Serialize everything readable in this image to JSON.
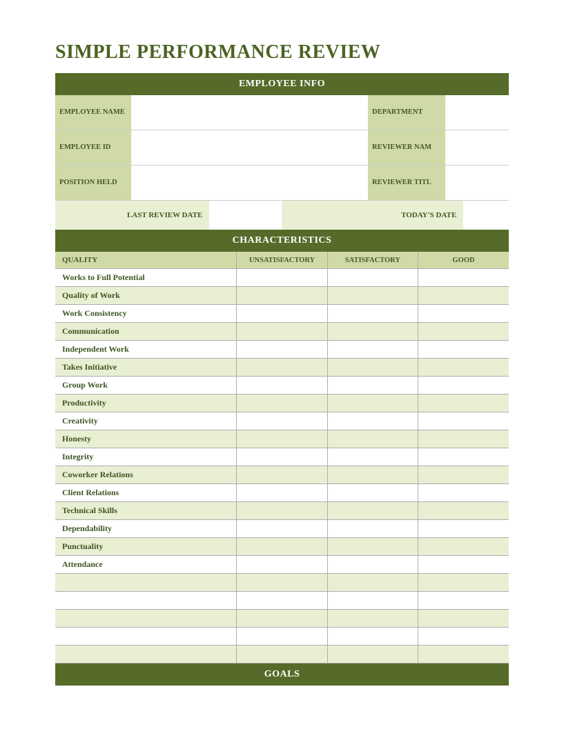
{
  "title": "SIMPLE PERFORMANCE REVIEW",
  "sections": {
    "employee_info": "EMPLOYEE INFO",
    "characteristics": "CHARACTERISTICS",
    "goals": "GOALS"
  },
  "employee_info": {
    "labels": {
      "employee_name": "EMPLOYEE NAME",
      "employee_id": "EMPLOYEE ID",
      "position_held": "POSITION HELD",
      "department": "DEPARTMENT",
      "reviewer_name": "REVIEWER NAM",
      "reviewer_title": "REVIEWER TITL",
      "last_review_date": "LAST REVIEW DATE",
      "todays_date": "TODAY'S DATE"
    },
    "values": {
      "employee_name": "",
      "employee_id": "",
      "position_held": "",
      "department": "",
      "reviewer_name": "",
      "reviewer_title": "",
      "last_review_date": "",
      "todays_date": ""
    }
  },
  "characteristics": {
    "columns": {
      "quality": "QUALITY",
      "unsatisfactory": "UNSATISFACTORY",
      "satisfactory": "SATISFACTORY",
      "good": "GOOD"
    },
    "rows": [
      "Works to Full Potential",
      "Quality of Work",
      "Work Consistency",
      "Communication",
      "Independent Work",
      "Takes Initiative",
      "Group Work",
      "Productivity",
      "Creativity",
      "Honesty",
      "Integrity",
      "Coworker Relations",
      "Client Relations",
      "Technical Skills",
      "Dependability",
      "Punctuality",
      "Attendance",
      "",
      "",
      "",
      "",
      ""
    ]
  }
}
